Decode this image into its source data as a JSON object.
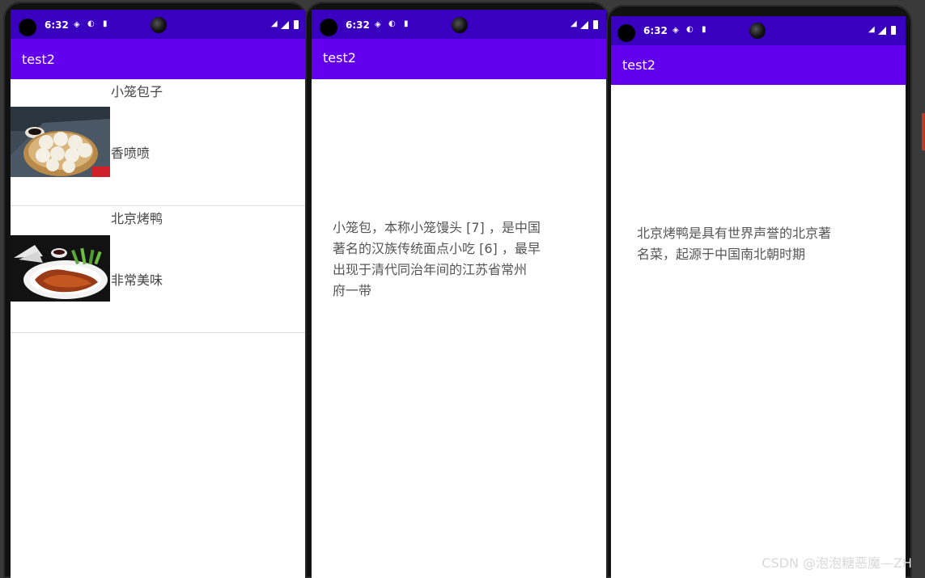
{
  "phones": [
    {
      "time": "6:32",
      "app_title": "test2"
    },
    {
      "time": "6:32",
      "app_title": "test2"
    },
    {
      "time": "6:32",
      "app_title": "test2"
    }
  ],
  "list": {
    "items": [
      {
        "name": "小笼包子",
        "desc": "香喷喷",
        "image": "xiaolongbao-photo"
      },
      {
        "name": "北京烤鸭",
        "desc": "非常美味",
        "image": "roast-duck-photo"
      }
    ]
  },
  "detail_xiaolongbao": {
    "lines": [
      "小笼包，本称小笼馒头 [7] ，是中国",
      "著名的汉族传统面点小吃 [6] ，最早",
      "出现于清代同治年间的江苏省常州",
      "府一带"
    ]
  },
  "detail_roastduck": {
    "lines": [
      "北京烤鸭是具有世界声誉的北京著",
      "名菜，起源于中国南北朝时期"
    ]
  },
  "watermark": "CSDN @泡泡糖恶魔—ZH",
  "colors": {
    "status_bar": "#3a00c0",
    "app_bar": "#6200ee"
  }
}
